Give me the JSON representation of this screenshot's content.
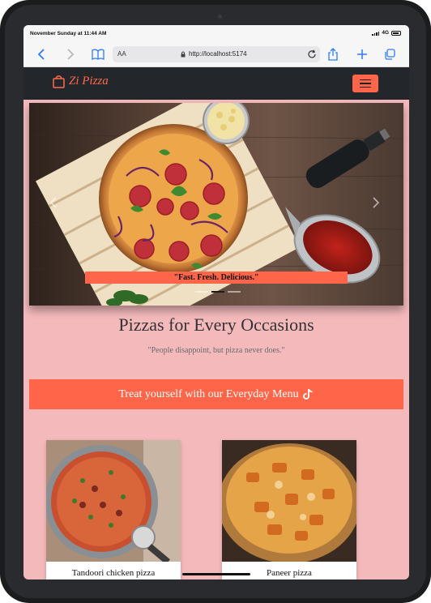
{
  "status_bar": {
    "time": "November Sunday at 11:44 AM",
    "network": "4G"
  },
  "browser": {
    "text_size_label": "AA",
    "url": "http://localhost:5174",
    "icons": [
      "chevron-left-icon",
      "chevron-right-icon",
      "book-icon",
      "lock-icon",
      "reload-icon",
      "share-icon",
      "plus-icon",
      "tabs-icon"
    ]
  },
  "navbar": {
    "brand": "Zi Pizza",
    "brand_icon": "shopping-bag-icon",
    "menu_icon": "hamburger-menu-icon",
    "accent_color": "#ff6548",
    "background_color": "#23262b"
  },
  "hero": {
    "caption": "\"Fast. Fresh. Delicious.\"",
    "slide_count": 3,
    "active_slide": 2
  },
  "main": {
    "heading": "Pizzas for Every Occasions",
    "quote": "\"People disappoint, but pizza never does.\"",
    "menu_button": "Treat yourself with our Everyday Menu",
    "menu_button_icon": "tiktok-icon"
  },
  "cards": [
    {
      "title": "Tandoori chicken pizza"
    },
    {
      "title": "Paneer pizza"
    }
  ],
  "colors": {
    "page_background": "#f4b9bb",
    "accent": "#ff6548"
  }
}
